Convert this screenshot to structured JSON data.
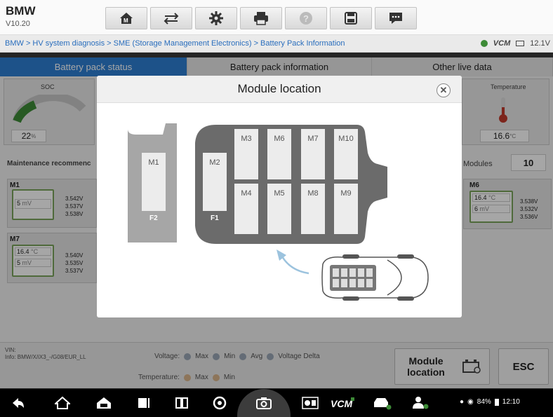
{
  "app": {
    "name": "BMW",
    "version": "V10.20"
  },
  "toolbar": {
    "icons": [
      "home-icon",
      "car-swap-icon",
      "gear-icon",
      "print-icon",
      "help-icon",
      "save-icon",
      "message-icon"
    ]
  },
  "breadcrumb": {
    "text": "BMW > HV system diagnosis > SME (Storage Management Electronics) > Battery Pack Information",
    "vcm": "VCM",
    "voltage": "12.1V"
  },
  "tabs": [
    {
      "label": "Battery pack status"
    },
    {
      "label": "Battery pack information"
    },
    {
      "label": "Other live data"
    }
  ],
  "left": {
    "soc_label": "SOC",
    "soc_value": "22",
    "soc_unit": "%",
    "maint_label": "Maintenance recommenc",
    "modules": [
      {
        "name": "M1",
        "temp": "",
        "volt": "5",
        "unit": "mV",
        "v1": "3.542V",
        "v2": "3.537V",
        "v3": "3.538V"
      },
      {
        "name": "M7",
        "temp": "16.4",
        "temp_unit": "°C",
        "volt": "5",
        "unit": "mV",
        "v1": "3.540V",
        "v2": "3.535V",
        "v3": "3.537V"
      }
    ]
  },
  "right": {
    "temp_label": "Temperature",
    "temp_value": "16.6",
    "temp_unit": "°C",
    "modules_label": "Modules",
    "modules_count": "10",
    "module": {
      "name": "M6",
      "temp": "16.4",
      "temp_unit": "°C",
      "volt": "6",
      "unit": "mV",
      "v1": "3.538V",
      "v2": "3.532V",
      "v3": "3.536V"
    }
  },
  "dialog": {
    "title": "Module location",
    "cells_top": [
      "M3",
      "M6",
      "M7",
      "M10"
    ],
    "cells_bottom": [
      "M4",
      "M5",
      "M8",
      "M9"
    ],
    "m1": "M1",
    "m2": "M2",
    "f2": "F2",
    "f1": "F1"
  },
  "bottom": {
    "vin_label": "VIN:",
    "info": "Info: BMW/X/iX3_-/G08/EUR_LL",
    "voltage_label": "Voltage:",
    "max": "Max",
    "min": "Min",
    "avg": "Avg",
    "delta": "Voltage Delta",
    "temperature_label": "Temperature:",
    "tmax": "Max",
    "tmin": "Min",
    "module_location_btn": "Module location",
    "esc_btn": "ESC"
  },
  "statusbar": {
    "battery": "84%",
    "time": "12:10"
  },
  "colors": {
    "accent": "#2d7fd3",
    "pack_gray": "#6b6b6b",
    "green": "#3d8b37"
  }
}
